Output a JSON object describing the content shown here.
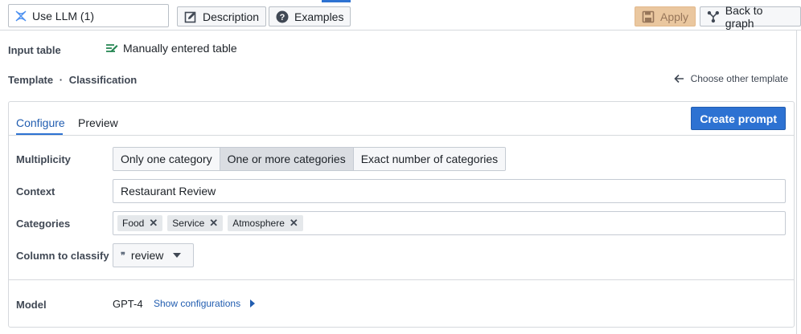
{
  "toolbar": {
    "name_value": "Use LLM (1)",
    "description_label": "Description",
    "examples_label": "Examples",
    "apply_label": "Apply",
    "back_label": "Back to graph"
  },
  "input_table": {
    "label": "Input table",
    "value": "Manually entered table"
  },
  "template": {
    "label": "Template",
    "separator": "·",
    "value": "Classification",
    "choose_other": "Choose other template"
  },
  "config_card": {
    "tabs": [
      {
        "label": "Configure",
        "active": true
      },
      {
        "label": "Preview",
        "active": false
      }
    ],
    "create_prompt_label": "Create prompt",
    "multiplicity": {
      "label": "Multiplicity",
      "options": [
        "Only one category",
        "One or more categories",
        "Exact number of categories"
      ],
      "selected": "One or more categories"
    },
    "context": {
      "label": "Context",
      "value": "Restaurant Review"
    },
    "categories": {
      "label": "Categories",
      "tags": [
        "Food",
        "Service",
        "Atmosphere"
      ]
    },
    "column": {
      "label": "Column to classify",
      "value": "review",
      "icon_glyph": "❞"
    },
    "model": {
      "label": "Model",
      "value": "GPT-4",
      "show_config_label": "Show configurations"
    }
  },
  "colors": {
    "accent": "#2d72d2",
    "apply_bg": "#eac79f",
    "table_icon": "#238551",
    "llm_icon": "#4c90f0"
  }
}
